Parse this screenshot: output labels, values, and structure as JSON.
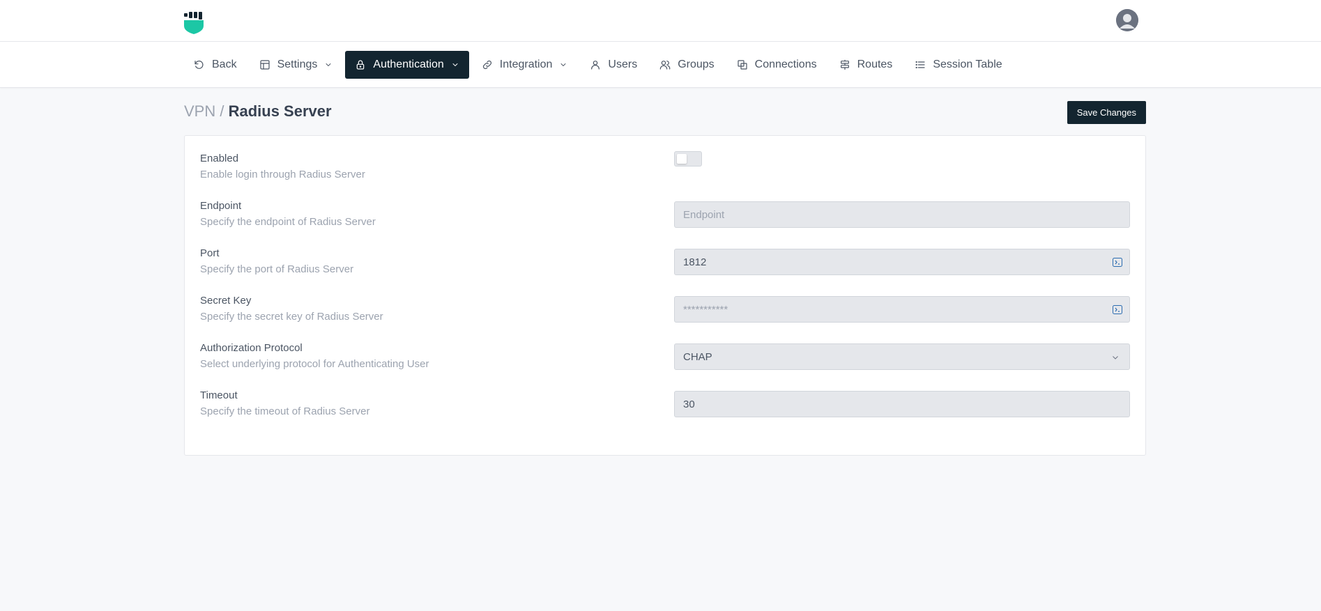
{
  "header": {
    "logo": "shield-logo",
    "avatar": "user-avatar"
  },
  "nav": {
    "items": [
      {
        "label": "Back",
        "icon": "undo-icon"
      },
      {
        "label": "Settings",
        "icon": "layout-icon"
      },
      {
        "label": "Authentication",
        "icon": "lock-icon",
        "active": true
      },
      {
        "label": "Integration",
        "icon": "link-icon"
      },
      {
        "label": "Users",
        "icon": "user-icon"
      },
      {
        "label": "Groups",
        "icon": "users-icon"
      },
      {
        "label": "Connections",
        "icon": "copy-icon"
      },
      {
        "label": "Routes",
        "icon": "signpost-icon"
      },
      {
        "label": "Session Table",
        "icon": "list-icon"
      }
    ]
  },
  "breadcrumb": {
    "parent": "VPN",
    "separator": " / ",
    "current": "Radius Server"
  },
  "actions": {
    "save_label": "Save Changes"
  },
  "form": {
    "enabled": {
      "label": "Enabled",
      "desc": "Enable login through Radius Server",
      "value": false
    },
    "endpoint": {
      "label": "Endpoint",
      "desc": "Specify the endpoint of Radius Server",
      "value": "",
      "placeholder": "Endpoint"
    },
    "port": {
      "label": "Port",
      "desc": "Specify the port of Radius Server",
      "value": "1812"
    },
    "secret": {
      "label": "Secret Key",
      "desc": "Specify the secret key of Radius Server",
      "value": "***********"
    },
    "protocol": {
      "label": "Authorization Protocol",
      "desc": "Select underlying protocol for Authenticating User",
      "value": "CHAP"
    },
    "timeout": {
      "label": "Timeout",
      "desc": "Specify the timeout of Radius Server",
      "value": "30"
    }
  },
  "colors": {
    "accent": "#132530",
    "brand_teal": "#1cc7a5"
  }
}
